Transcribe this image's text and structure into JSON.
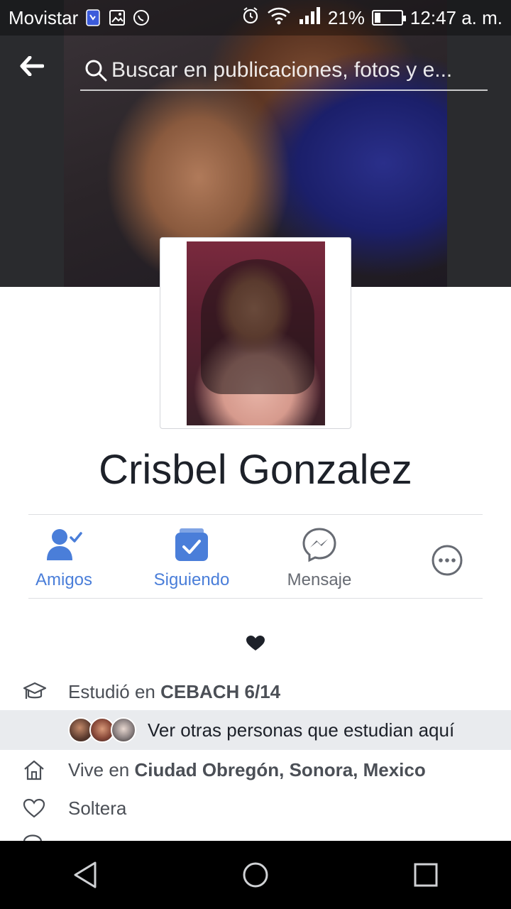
{
  "status_bar": {
    "carrier": "Movistar",
    "battery_percent": "21%",
    "battery_level": 0.21,
    "time": "12:47 a. m."
  },
  "header": {
    "search_placeholder": "Buscar en publicaciones, fotos y e..."
  },
  "profile": {
    "name": "Crisbel Gonzalez"
  },
  "actions": [
    {
      "label": "Amigos",
      "icon": "friends-check-icon"
    },
    {
      "label": "Siguiendo",
      "icon": "following-check-icon"
    },
    {
      "label": "Mensaje",
      "icon": "messenger-icon"
    },
    {
      "label": "",
      "icon": "more-icon"
    }
  ],
  "about": {
    "studied_prefix": "Estudió en ",
    "studied_place": "CEBACH 6/14",
    "see_others": "Ver otras personas que estudian aquí",
    "lives_prefix": "Vive en ",
    "lives_place": "Ciudad Obregón, Sonora, Mexico",
    "relationship": "Soltera"
  },
  "colors": {
    "accent_blue": "#4a7ed9",
    "text_gray": "#4b4f56"
  }
}
